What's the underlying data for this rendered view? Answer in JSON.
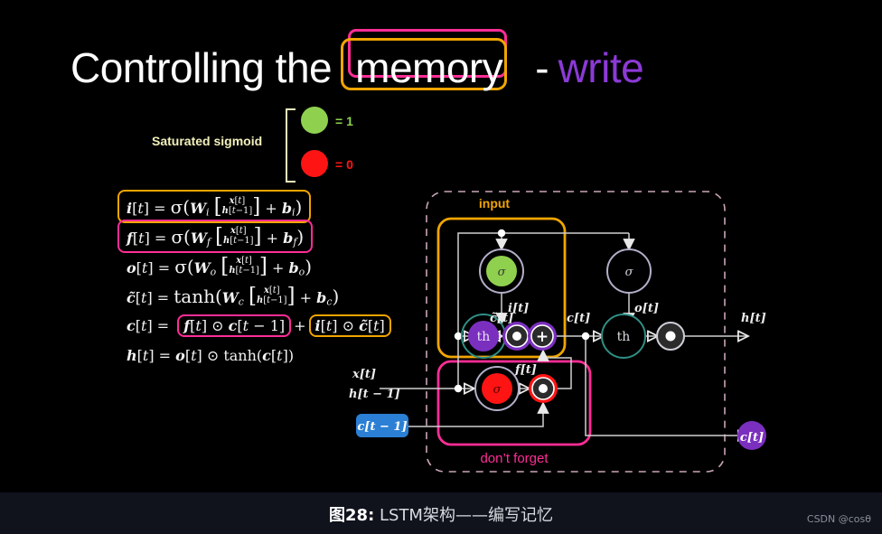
{
  "slide": {
    "title": {
      "prefix": "Controlling the",
      "highlight": "memory",
      "dash": "-",
      "suffix": "write",
      "highlight_box_colors": [
        "#ff2d96",
        "#f0a500"
      ],
      "suffix_color": "#8b3ad6"
    },
    "legend": {
      "label": "Saturated sigmoid",
      "items": [
        {
          "dot": "green-dot",
          "color": "#8fd14f",
          "text": "= 1"
        },
        {
          "dot": "red-dot",
          "color": "#ff1414",
          "text": "= 0"
        }
      ]
    },
    "equations": [
      {
        "id": "input-gate",
        "lhs": "i[t]",
        "highlight": "orange",
        "text": "i[t] = σ(W_i [x[t]; h[t-1]] + b_i)"
      },
      {
        "id": "forget-gate",
        "lhs": "f[t]",
        "highlight": "pink",
        "text": "f[t] = σ(W_f [x[t]; h[t-1]] + b_f)"
      },
      {
        "id": "output-gate",
        "lhs": "o[t]",
        "highlight": "none",
        "text": "o[t] = σ(W_o [x[t]; h[t-1]] + b_o)"
      },
      {
        "id": "candidate",
        "lhs": "c̃[t]",
        "highlight": "none",
        "text": "c̃[t] = tanh(W_c [x[t]; h[t-1]] + b_c)"
      },
      {
        "id": "cell-state",
        "lhs": "c[t]",
        "highlight": "split",
        "text": "c[t] = f[t] ⊙ c[t-1] + i[t] ⊙ c̃[t]"
      },
      {
        "id": "hidden-state",
        "lhs": "h[t]",
        "highlight": "none",
        "text": "h[t] = o[t] ⊙ tanh(c[t])"
      }
    ],
    "diagram": {
      "group_labels": [
        {
          "name": "input-group-label",
          "text": "input",
          "color": "#f0a500"
        },
        {
          "name": "forget-group-label",
          "text": "don’t forget",
          "color": "#ff2d96"
        }
      ],
      "inputs": [
        {
          "name": "x-input-label",
          "text": "x[t]"
        },
        {
          "name": "h-prev-label",
          "text": "h[t−1]"
        },
        {
          "name": "c-prev-label",
          "text": "c[t−1]",
          "badge_color": "#2b7fd4"
        }
      ],
      "outputs": [
        {
          "name": "h-output-label",
          "text": "h[t]"
        },
        {
          "name": "c-output-label",
          "text": "c[t]",
          "badge_color": "#7b2fbe"
        }
      ],
      "edge_labels": [
        {
          "name": "i-gate-signal-label",
          "text": "i[t]"
        },
        {
          "name": "cbar-signal-label",
          "text": "c̃[t]"
        },
        {
          "name": "f-gate-signal-label",
          "text": "f[t]"
        },
        {
          "name": "c-state-signal-label",
          "text": "c[t]"
        },
        {
          "name": "o-gate-signal-label",
          "text": "o[t]"
        }
      ],
      "nodes": [
        {
          "name": "input-sigmoid-node",
          "glyph": "σ",
          "fill": "#8fd14f",
          "ring": "#b3aec8"
        },
        {
          "name": "candidate-tanh-node",
          "glyph": "th",
          "fill": "#7b2fbe",
          "ring": "#2f8f84"
        },
        {
          "name": "input-product-node",
          "glyph": "●",
          "fill": "#2b2b2b",
          "ring": "#7b2fbe"
        },
        {
          "name": "sum-node",
          "glyph": "+",
          "fill": "#2b2b2b",
          "ring": "#7b2fbe"
        },
        {
          "name": "forget-sigmoid-node",
          "glyph": "σ",
          "fill": "#ff1414",
          "ring": "#b3aec8"
        },
        {
          "name": "forget-product-node",
          "glyph": "●",
          "fill": "#2b2b2b",
          "ring": "#ff1414"
        },
        {
          "name": "output-sigmoid-node",
          "glyph": "σ",
          "fill": "#000000",
          "ring": "#b3aec8"
        },
        {
          "name": "output-tanh-node",
          "glyph": "th",
          "fill": "#000000",
          "ring": "#2f8f84"
        },
        {
          "name": "output-product-node",
          "glyph": "●",
          "fill": "#2b2b2b",
          "ring": "#cfcfd8"
        }
      ]
    }
  },
  "caption": {
    "figure": "图28:",
    "text": " LSTM架构——编写记忆"
  },
  "watermark": {
    "text": "CSDN @cosθ"
  }
}
